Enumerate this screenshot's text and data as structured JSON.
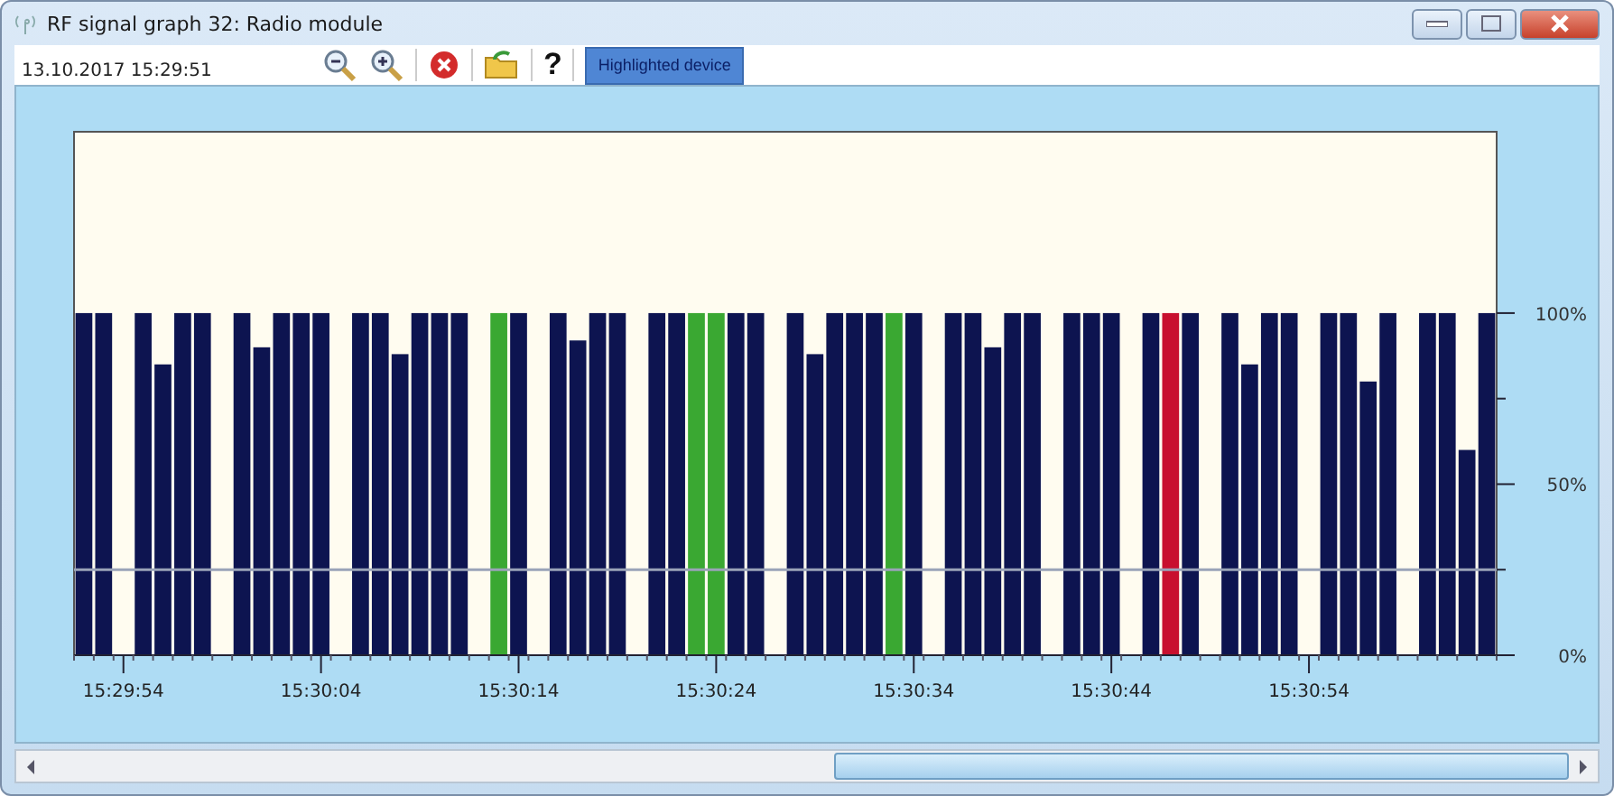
{
  "window": {
    "title": "RF signal graph 32: Radio module"
  },
  "toolbar": {
    "timestamp": "13.10.2017 15:29:51",
    "help": "?",
    "highlight_button": {
      "label": "Highlighted device",
      "selected": true
    }
  },
  "chart_data": {
    "type": "bar",
    "stacked": true,
    "ylim": [
      0,
      153
    ],
    "categories": [
      null,
      null,
      "15:29:54",
      null,
      null,
      null,
      null,
      null,
      null,
      null,
      null,
      null,
      "15:30:04",
      null,
      null,
      null,
      null,
      null,
      null,
      null,
      null,
      null,
      "15:30:14",
      null,
      null,
      null,
      null,
      null,
      null,
      null,
      null,
      null,
      "15:30:24",
      null,
      null,
      null,
      null,
      null,
      null,
      null,
      null,
      null,
      "15:30:34",
      null,
      null,
      null,
      null,
      null,
      null,
      null,
      null,
      null,
      "15:30:44",
      null,
      null,
      null,
      null,
      null,
      null,
      null,
      null,
      null,
      "15:30:54",
      null,
      null,
      null,
      null,
      null,
      null,
      null,
      null,
      null
    ],
    "yticks": [
      {
        "value": 0,
        "label": "0%"
      },
      {
        "value": 50,
        "label": "50%"
      },
      {
        "value": 100,
        "label": "100%"
      }
    ],
    "series": [
      {
        "color": "#0d1450",
        "values": [
          100,
          100,
          0,
          100,
          85,
          100,
          100,
          0,
          100,
          90,
          100,
          100,
          100,
          0,
          100,
          100,
          88,
          100,
          100,
          100,
          0,
          null,
          100,
          0,
          100,
          92,
          100,
          100,
          0,
          100,
          100,
          null,
          null,
          100,
          100,
          0,
          100,
          88,
          100,
          100,
          100,
          null,
          100,
          0,
          100,
          100,
          90,
          100,
          100,
          0,
          100,
          100,
          100,
          0,
          100,
          null,
          100,
          0,
          100,
          85,
          100,
          100,
          0,
          100,
          100,
          80,
          100,
          0,
          100,
          100,
          60,
          100
        ]
      },
      {
        "color": "#3aa832",
        "values": [
          null,
          null,
          null,
          null,
          null,
          null,
          null,
          null,
          null,
          null,
          null,
          null,
          null,
          null,
          null,
          null,
          null,
          null,
          null,
          null,
          null,
          100,
          null,
          null,
          null,
          null,
          null,
          null,
          null,
          null,
          null,
          100,
          100,
          null,
          null,
          null,
          null,
          null,
          null,
          null,
          null,
          100,
          null,
          null,
          null,
          null,
          null,
          null,
          null,
          null,
          null,
          null,
          null,
          null,
          null,
          null,
          null,
          null,
          null,
          null,
          null,
          null,
          null,
          null,
          null,
          null,
          null,
          null,
          null,
          null,
          null,
          null
        ]
      },
      {
        "color": "#c8102e",
        "values": [
          null,
          null,
          null,
          null,
          null,
          null,
          null,
          null,
          null,
          null,
          null,
          null,
          null,
          null,
          null,
          null,
          null,
          null,
          null,
          null,
          null,
          null,
          null,
          null,
          null,
          null,
          null,
          null,
          null,
          null,
          null,
          null,
          null,
          null,
          null,
          null,
          null,
          null,
          null,
          null,
          null,
          null,
          null,
          null,
          null,
          null,
          null,
          null,
          null,
          null,
          null,
          null,
          null,
          null,
          null,
          100,
          null,
          null,
          null,
          null,
          null,
          null,
          null,
          null,
          null,
          null,
          null,
          null,
          null,
          null,
          null,
          null
        ]
      }
    ],
    "ref_lines": [
      {
        "axis": "y",
        "value": 25
      }
    ]
  }
}
